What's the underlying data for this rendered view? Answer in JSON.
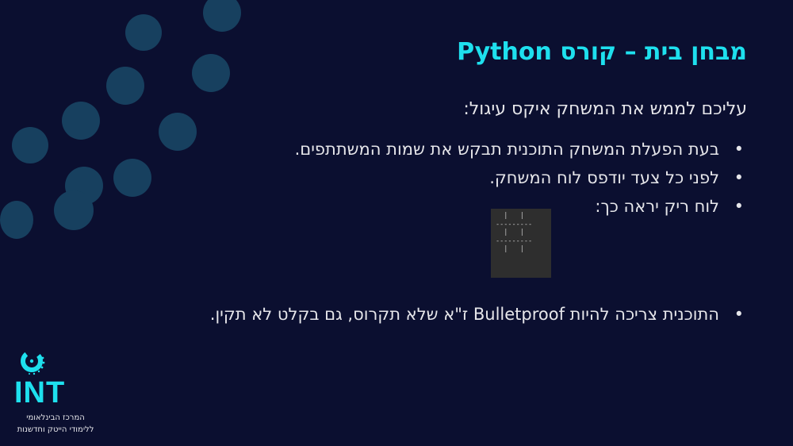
{
  "slide": {
    "title": "מבחן בית – קורס Python",
    "intro": "עליכם לממש את המשחק איקס עיגול:",
    "bullets": [
      "בעת הפעלת המשחק התוכנית תבקש את שמות המשתתפים.",
      "לפני כל צעד יודפס לוח המשחק.",
      "לוח ריק יראה כך:",
      "התוכנית צריכה להיות Bulletproof ז\"א שלא תקרוס, גם בקלט לא תקין."
    ],
    "board_text": "  |   |\n---------\n  |   |\n---------\n  |   |"
  },
  "logo": {
    "name": "INT",
    "line1": "המרכז הבינלאומי",
    "line2": "ללימודי הייטק וחדשנות"
  },
  "colors": {
    "background": "#0b0f30",
    "accent": "#1ee0ee",
    "dot": "#17405f",
    "text": "#e6e6ea"
  }
}
